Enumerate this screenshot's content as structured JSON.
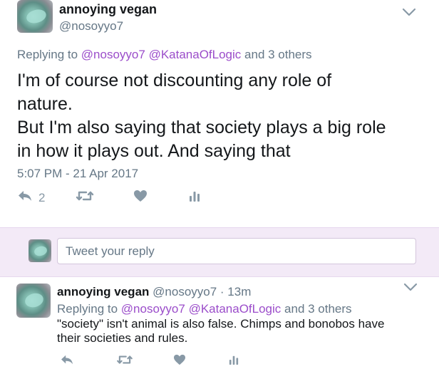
{
  "main_tweet": {
    "display_name": "annoying vegan",
    "handle": "@nosoyyo7",
    "replying_prefix": "Replying to",
    "mention_1": "@nosoyyo7",
    "mention_2": "@KatanaOfLogic",
    "replying_suffix": "and 3 others",
    "text_lines": [
      "I'm of course not discounting any role of",
      "nature.",
      "But I'm also saying that society plays a big role",
      "in how it plays out. And saying that"
    ],
    "timestamp": "5:07 PM - 21 Apr 2017",
    "reply_count": "2"
  },
  "composer": {
    "placeholder": "Tweet your reply"
  },
  "reply_tweet": {
    "display_name": "annoying vegan",
    "meta": "@nosoyyo7 · 13m",
    "replying_prefix": "Replying to",
    "mention_1": "@nosoyyo7",
    "mention_2": "@KatanaOfLogic",
    "replying_suffix": "and 3 others",
    "text_lines": [
      "\"society\" isn't animal is also false. Chimps and bonobos have",
      "their societies and rules."
    ]
  },
  "icons": {
    "reply": "reply-icon",
    "retweet": "retweet-icon",
    "like": "heart-icon",
    "stats": "stats-icon",
    "menu": "chevron-down-icon"
  },
  "colors": {
    "mention": "#9b4dca",
    "secondary_text": "#657786",
    "composer_background": "#f3eaf7"
  }
}
